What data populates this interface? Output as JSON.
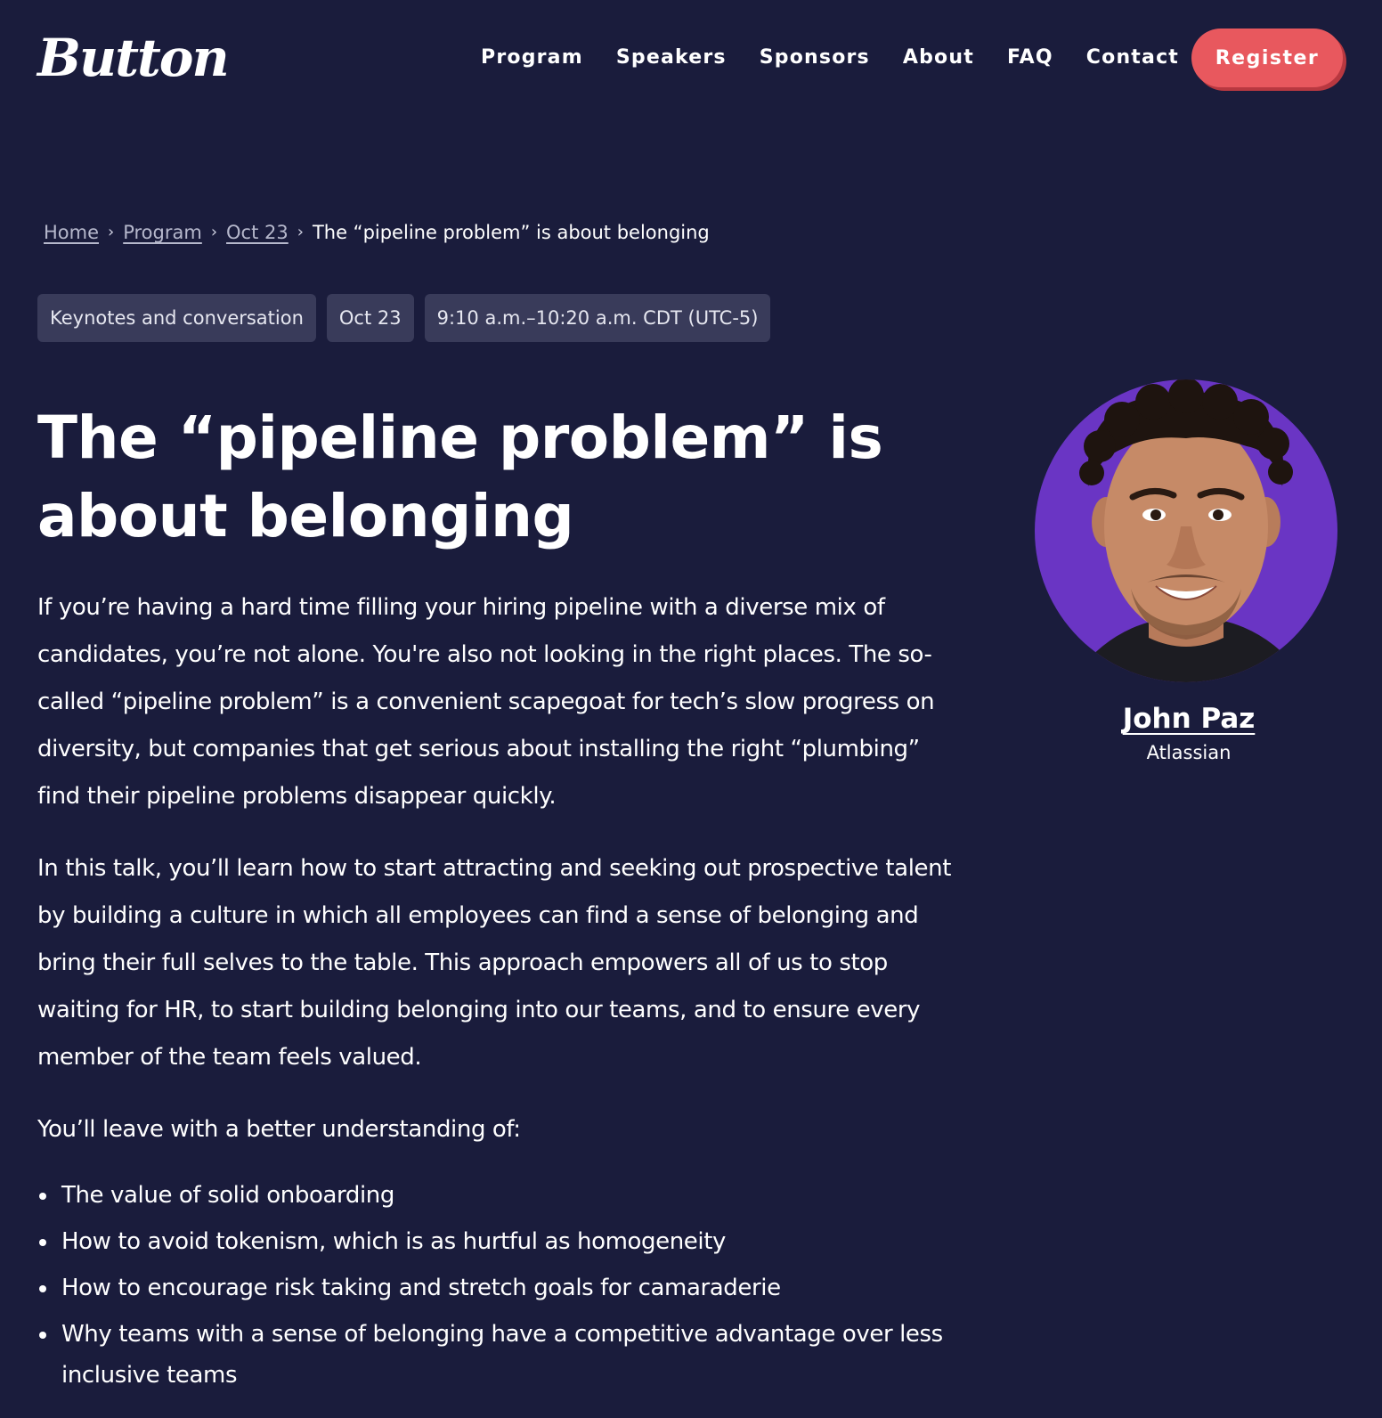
{
  "header": {
    "logo": "Button",
    "nav": [
      "Program",
      "Speakers",
      "Sponsors",
      "About",
      "FAQ",
      "Contact"
    ],
    "register_label": "Register"
  },
  "breadcrumb": {
    "items": [
      "Home",
      "Program",
      "Oct 23"
    ],
    "current": "The “pipeline problem” is about belonging",
    "separator": "›"
  },
  "tags": [
    "Keynotes and conversation",
    "Oct 23",
    "9:10 a.m.–10:20 a.m. CDT (UTC-5)"
  ],
  "title": "The “pipeline problem” is about belonging",
  "body": {
    "paragraphs": [
      "If you’re having a hard time filling your hiring pipeline with a diverse mix of candidates, you’re not alone. You're also not looking in the right places. The so-called “pipeline problem” is a convenient scapegoat for tech’s slow progress on diversity, but companies that get serious about installing the right “plumbing” find their pipeline problems disappear quickly.",
      "In this talk, you’ll learn how to start attracting and seeking out prospective talent by building a culture in which all employees can find a sense of belonging and bring their full selves to the table. This approach empowers all of us to stop waiting for HR, to start building belonging into our teams, and to ensure every member of the team feels valued."
    ],
    "list_intro": "You’ll leave with a better understanding of:",
    "bullets": [
      "The value of solid onboarding",
      "How to avoid tokenism, which is as hurtful as homogeneity",
      "How to encourage risk taking and stretch goals for camaraderie",
      "Why teams with a sense of belonging have a competitive advantage over less inclusive teams"
    ]
  },
  "speaker": {
    "name": "John Paz",
    "company": "Atlassian",
    "avatar_bg": "#6a35c4"
  },
  "colors": {
    "background": "#1a1c3c",
    "accent": "#e8585e",
    "tag_bg": "#393b5a"
  }
}
